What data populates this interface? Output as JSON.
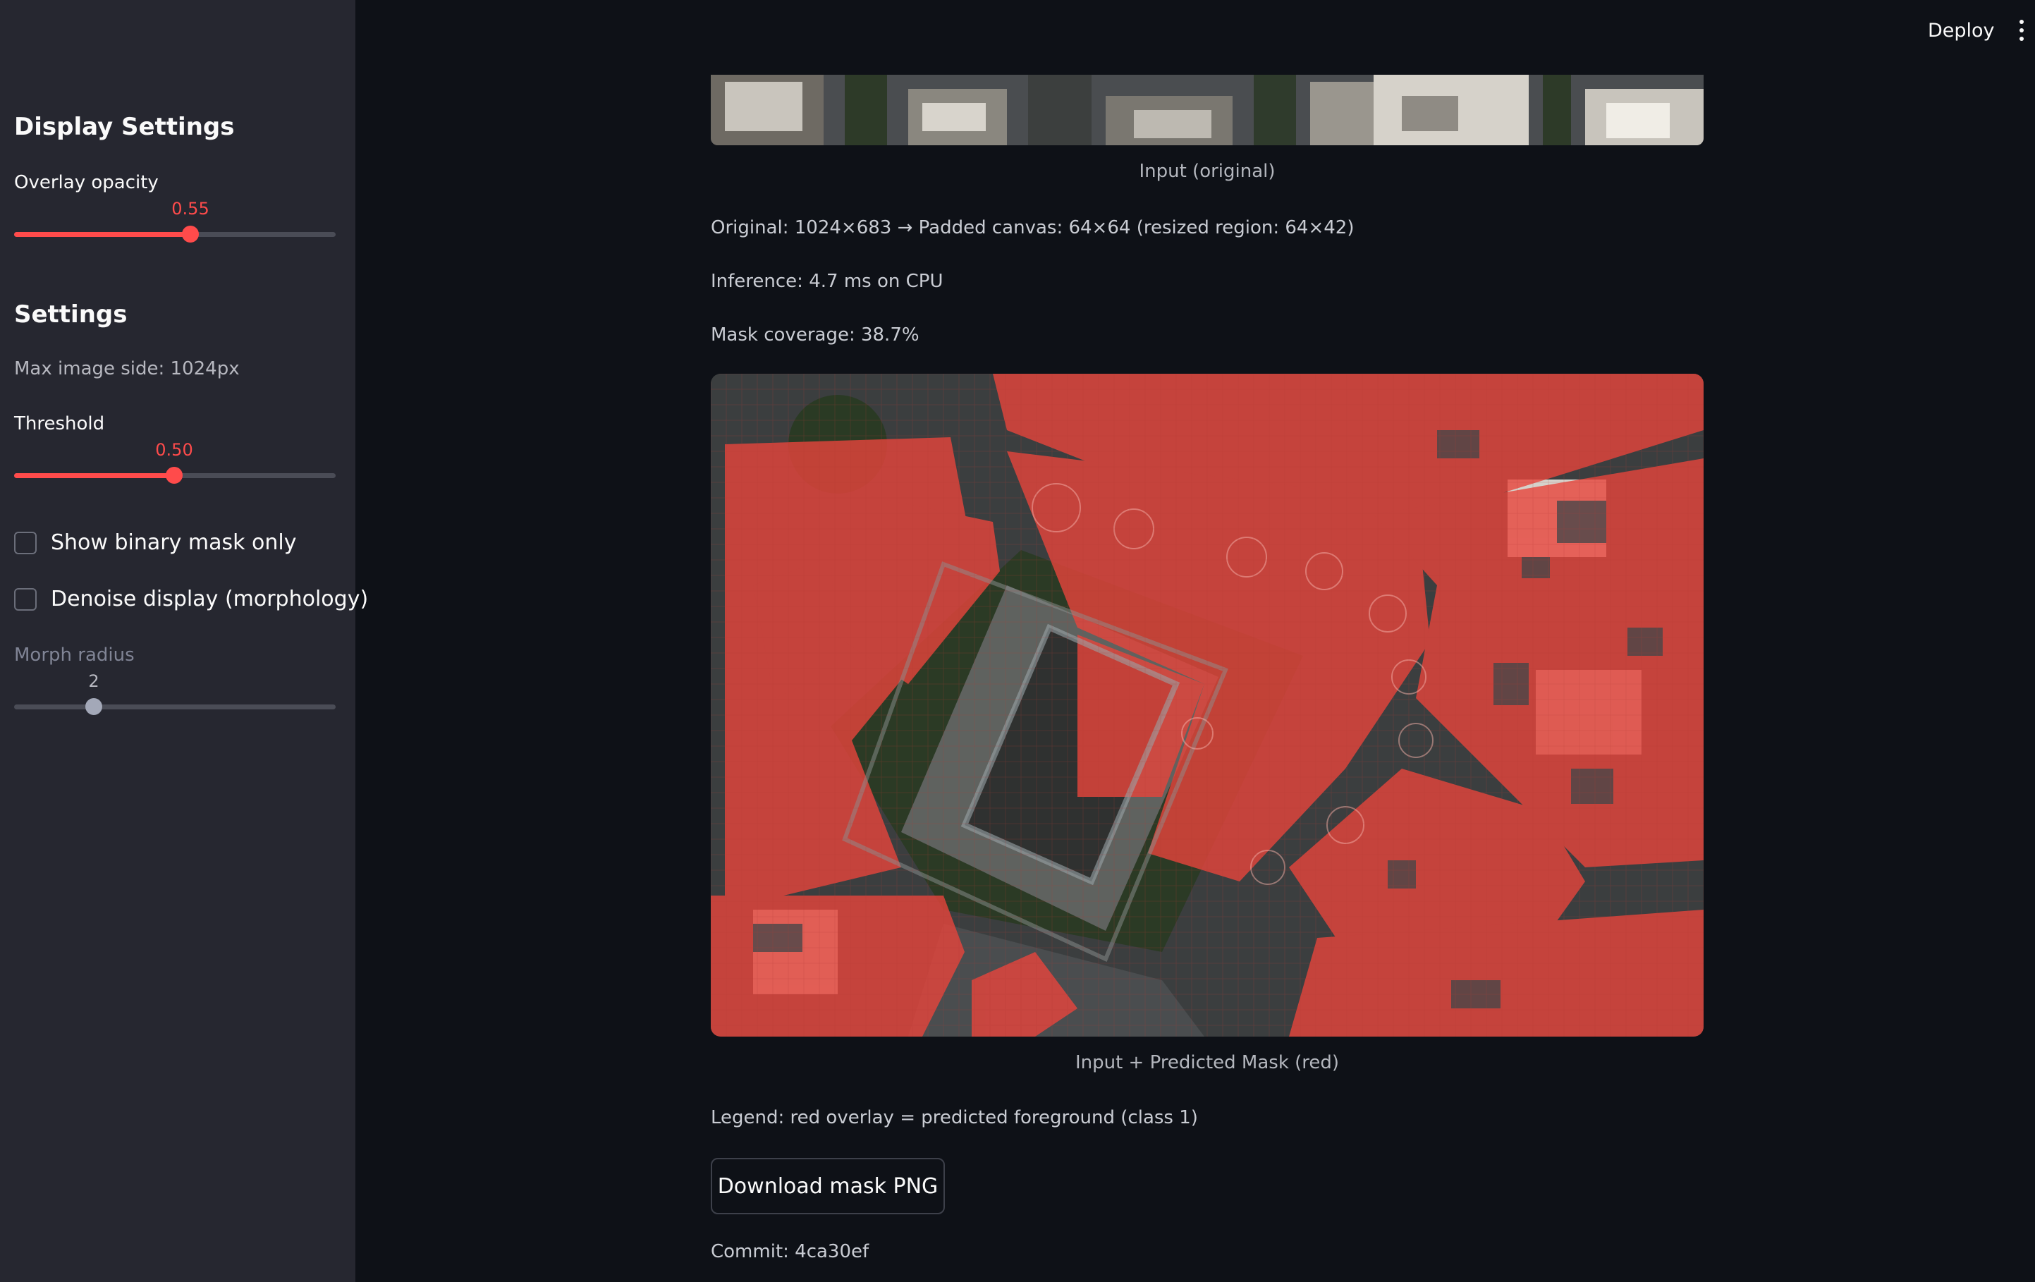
{
  "header": {
    "deploy_label": "Deploy"
  },
  "sidebar": {
    "display_settings_title": "Display Settings",
    "overlay_opacity": {
      "label": "Overlay opacity",
      "value": "0.55",
      "fraction": 0.55
    },
    "settings_title": "Settings",
    "max_image_side": "Max image side: 1024px",
    "threshold": {
      "label": "Threshold",
      "value": "0.50",
      "fraction": 0.5
    },
    "show_binary_mask": {
      "label": "Show binary mask only",
      "checked": false
    },
    "denoise_display": {
      "label": "Denoise display (morphology)",
      "checked": false
    },
    "morph_radius": {
      "label": "Morph radius",
      "value": "2",
      "fraction": 0.25,
      "disabled": true
    }
  },
  "main": {
    "input_caption": "Input (original)",
    "original_info": "Original: 1024×683 → Padded canvas: 64×64 (resized region: 64×42)",
    "inference_info": "Inference: 4.7 ms on CPU",
    "mask_coverage": "Mask coverage: 38.7%",
    "overlay_caption": "Input + Predicted Mask (red)",
    "legend": "Legend: red overlay = predicted foreground (class 1)",
    "download_button": "Download mask PNG",
    "commit": "Commit: 4ca30ef"
  },
  "colors": {
    "accent": "#ff4b4b",
    "background": "#0e1117",
    "sidebar": "#262730",
    "mask_overlay": "#e8453c"
  }
}
